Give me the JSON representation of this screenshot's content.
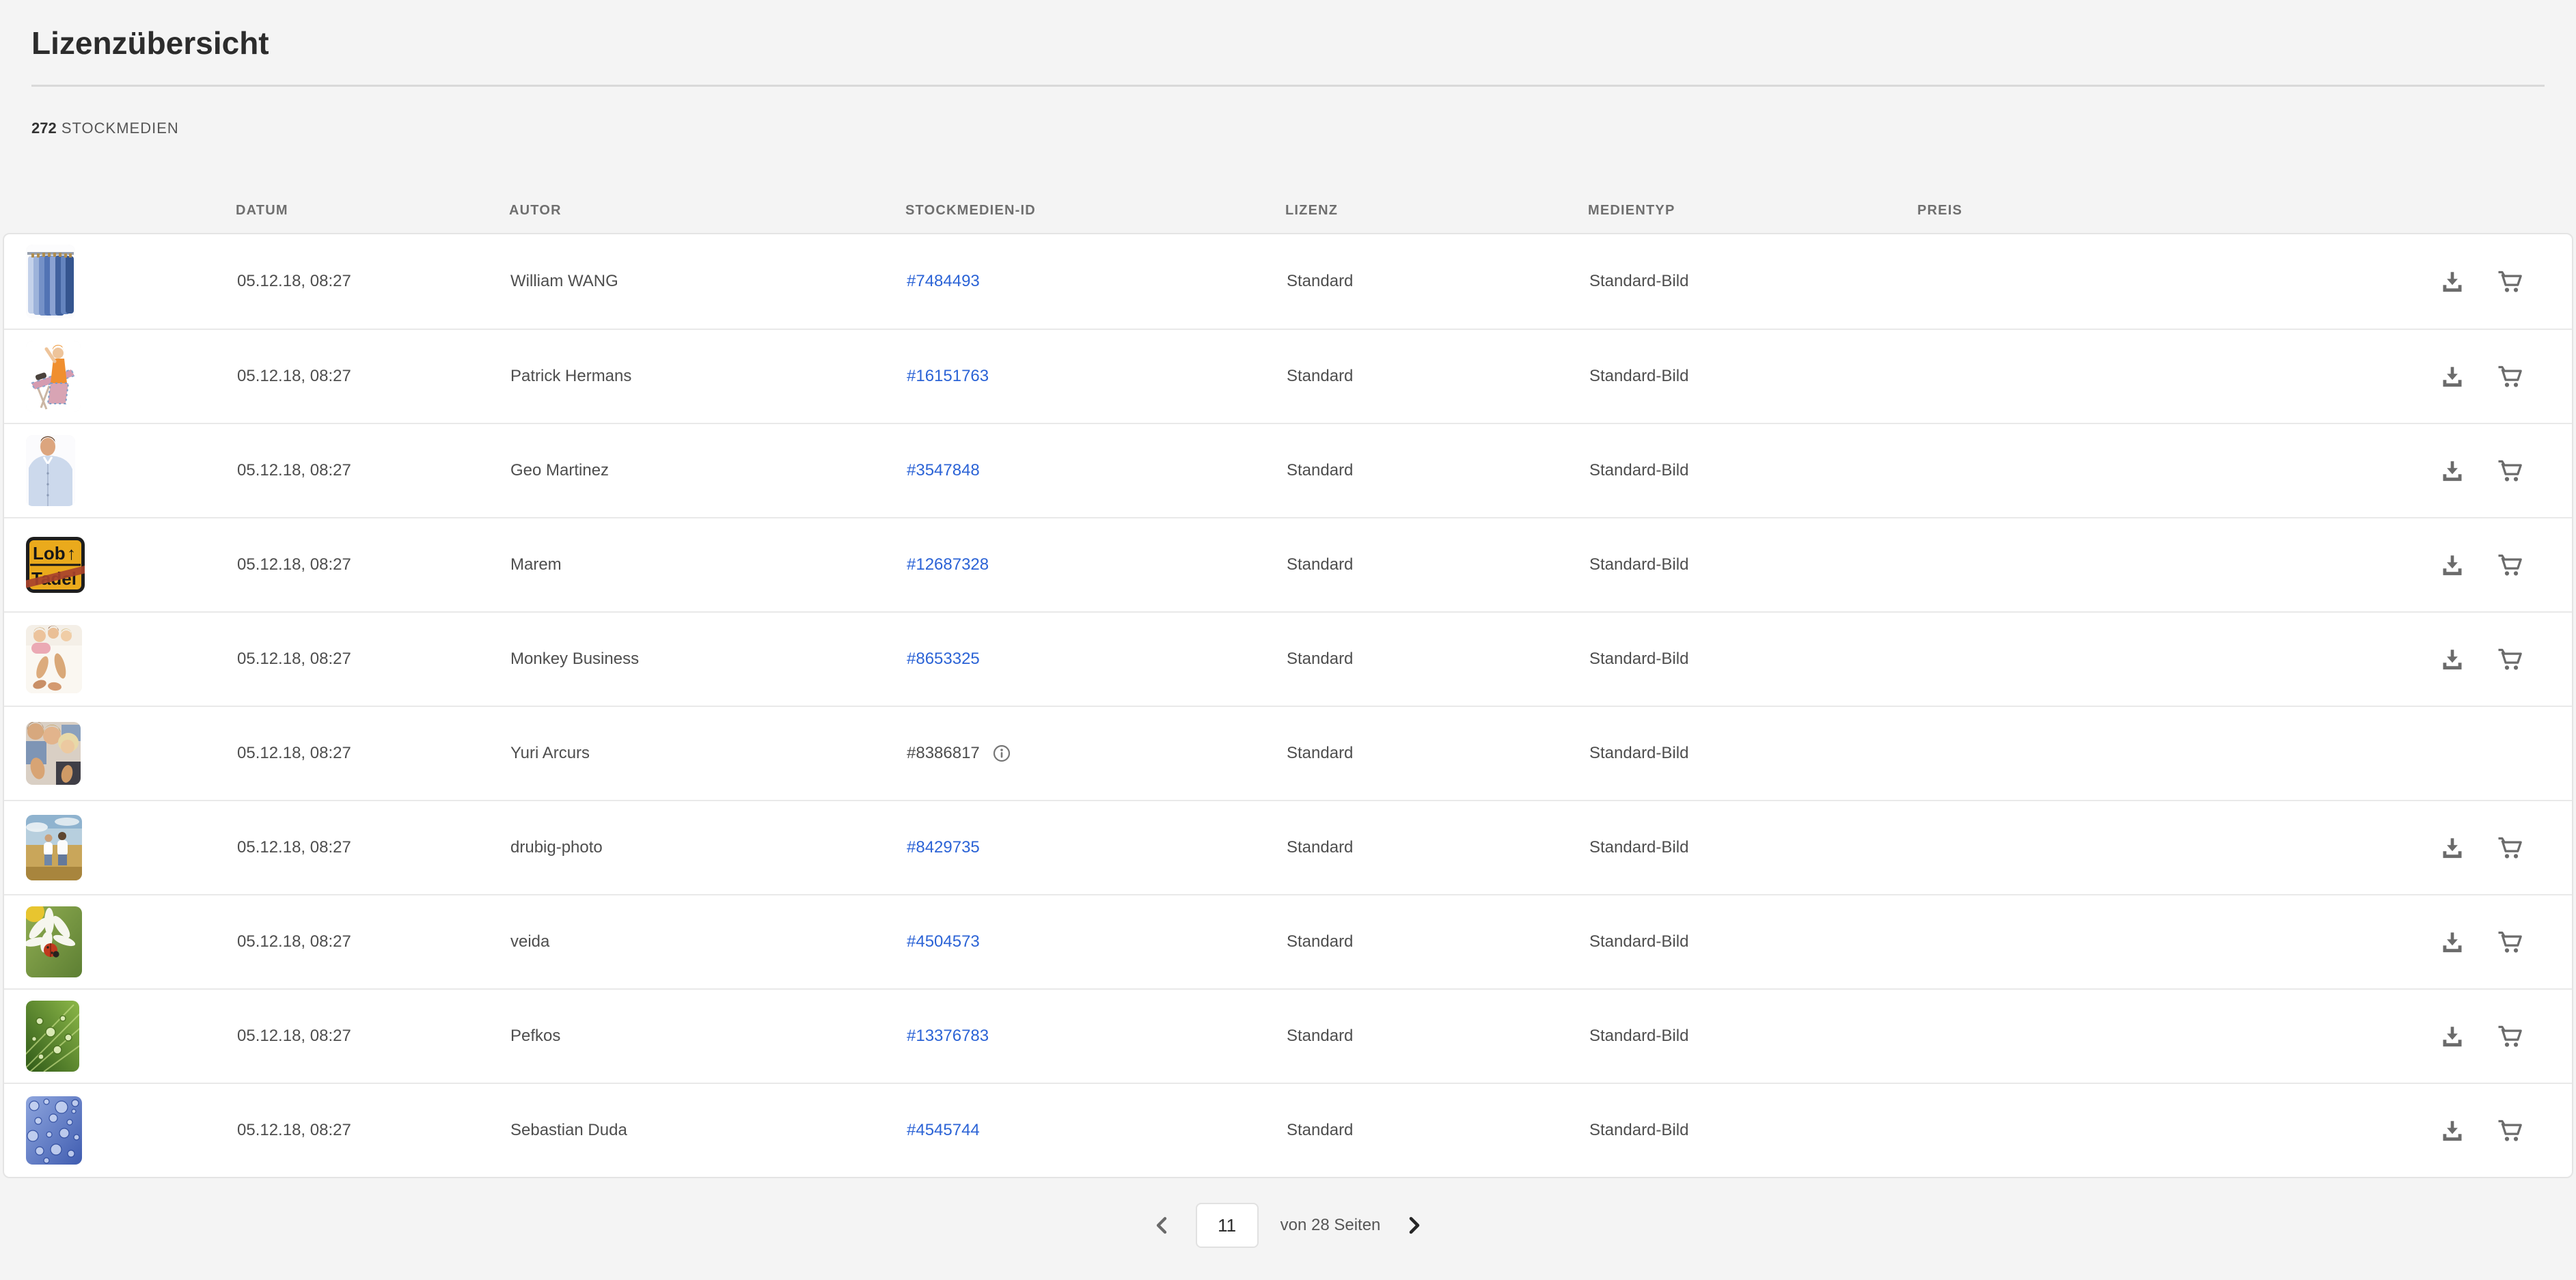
{
  "page": {
    "title": "Lizenzübersicht",
    "count": "272",
    "count_label": "STOCKMEDIEN"
  },
  "table": {
    "columns": [
      "DATUM",
      "AUTOR",
      "STOCKMEDIEN-ID",
      "LIZENZ",
      "MEDIENTYP",
      "PREIS"
    ],
    "rows": [
      {
        "thumb": "shirts-on-hangers",
        "date": "05.12.18, 08:27",
        "author": "William WANG",
        "id": "#7484493",
        "id_is_link": true,
        "has_info": false,
        "license": "Standard",
        "media_type": "Standard-Bild",
        "price": "",
        "has_actions": true
      },
      {
        "thumb": "ironing-woman",
        "date": "05.12.18, 08:27",
        "author": "Patrick Hermans",
        "id": "#16151763",
        "id_is_link": true,
        "has_info": false,
        "license": "Standard",
        "media_type": "Standard-Bild",
        "price": "",
        "has_actions": true
      },
      {
        "thumb": "man-blue-shirt",
        "date": "05.12.18, 08:27",
        "author": "Geo Martinez",
        "id": "#3547848",
        "id_is_link": true,
        "has_info": false,
        "license": "Standard",
        "media_type": "Standard-Bild",
        "price": "",
        "has_actions": true
      },
      {
        "thumb": "sign-lob-tadel",
        "date": "05.12.18, 08:27",
        "author": "Marem",
        "id": "#12687328",
        "id_is_link": true,
        "has_info": false,
        "license": "Standard",
        "media_type": "Standard-Bild",
        "price": "",
        "has_actions": true
      },
      {
        "thumb": "family-on-bed",
        "date": "05.12.18, 08:27",
        "author": "Monkey Business",
        "id": "#8653325",
        "id_is_link": true,
        "has_info": false,
        "license": "Standard",
        "media_type": "Standard-Bild",
        "price": "",
        "has_actions": true
      },
      {
        "thumb": "thumbs-up-group",
        "date": "05.12.18, 08:27",
        "author": "Yuri Arcurs",
        "id": "#8386817",
        "id_is_link": false,
        "has_info": true,
        "license": "Standard",
        "media_type": "Standard-Bild",
        "price": "",
        "has_actions": false
      },
      {
        "thumb": "couple-in-field",
        "date": "05.12.18, 08:27",
        "author": "drubig-photo",
        "id": "#8429735",
        "id_is_link": true,
        "has_info": false,
        "license": "Standard",
        "media_type": "Standard-Bild",
        "price": "",
        "has_actions": true
      },
      {
        "thumb": "daisy-ladybug",
        "date": "05.12.18, 08:27",
        "author": "veida",
        "id": "#4504573",
        "id_is_link": true,
        "has_info": false,
        "license": "Standard",
        "media_type": "Standard-Bild",
        "price": "",
        "has_actions": true
      },
      {
        "thumb": "leaf-waterdrops",
        "date": "05.12.18, 08:27",
        "author": "Pefkos",
        "id": "#13376783",
        "id_is_link": true,
        "has_info": false,
        "license": "Standard",
        "media_type": "Standard-Bild",
        "price": "",
        "has_actions": true
      },
      {
        "thumb": "blue-waterdrops",
        "date": "05.12.18, 08:27",
        "author": "Sebastian Duda",
        "id": "#4545744",
        "id_is_link": true,
        "has_info": false,
        "license": "Standard",
        "media_type": "Standard-Bild",
        "price": "",
        "has_actions": true
      }
    ]
  },
  "pagination": {
    "current_page": "11",
    "label": "von 28 Seiten"
  },
  "icons": {
    "download": "download-icon",
    "cart": "add-to-cart-icon",
    "info": "info-icon",
    "prev": "chevron-left-icon",
    "next": "chevron-right-icon"
  },
  "colors": {
    "page_bg": "#f4f4f4",
    "card_bg": "#ffffff",
    "border": "#e4e4e4",
    "link_blue": "#2b63d6",
    "text": "#4e4e4e",
    "muted": "#6f6f6f",
    "icon_gray": "#6b6b6b"
  }
}
